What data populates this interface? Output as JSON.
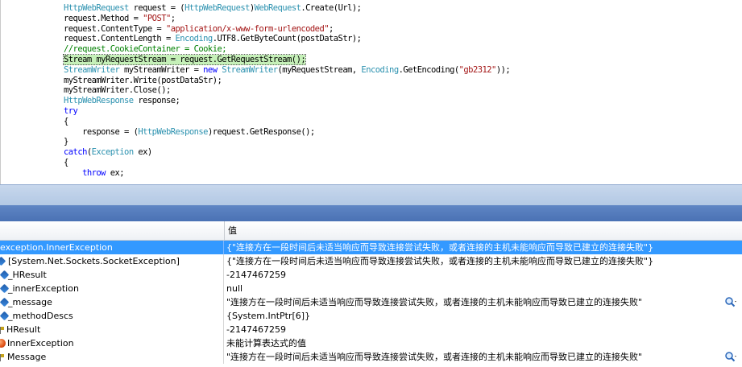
{
  "editor": {
    "lines": [
      [
        {
          "t": "HttpWebRequest",
          "c": "type"
        },
        {
          "t": " request = (",
          "c": "pl"
        },
        {
          "t": "HttpWebRequest",
          "c": "type"
        },
        {
          "t": ")",
          "c": "pl"
        },
        {
          "t": "WebRequest",
          "c": "type"
        },
        {
          "t": ".Create(Url);",
          "c": "pl"
        }
      ],
      [
        {
          "t": "request.Method = ",
          "c": "pl"
        },
        {
          "t": "\"POST\"",
          "c": "str"
        },
        {
          "t": ";",
          "c": "pl"
        }
      ],
      [
        {
          "t": "request.ContentType = ",
          "c": "pl"
        },
        {
          "t": "\"application/x-www-form-urlencoded\"",
          "c": "str"
        },
        {
          "t": ";",
          "c": "pl"
        }
      ],
      [
        {
          "t": "request.ContentLength = ",
          "c": "pl"
        },
        {
          "t": "Encoding",
          "c": "type"
        },
        {
          "t": ".UTF8.GetByteCount(postDataStr);",
          "c": "pl"
        }
      ],
      [
        {
          "t": "//request.CookieContainer = Cookie;",
          "c": "cm"
        }
      ],
      [
        {
          "t": "Stream myRequestStream = request.GetRequestStream();",
          "c": "pl"
        }
      ],
      [
        {
          "t": "StreamWriter",
          "c": "type"
        },
        {
          "t": " myStreamWriter = ",
          "c": "pl"
        },
        {
          "t": "new",
          "c": "kw"
        },
        {
          "t": " ",
          "c": "pl"
        },
        {
          "t": "StreamWriter",
          "c": "type"
        },
        {
          "t": "(myRequestStream, ",
          "c": "pl"
        },
        {
          "t": "Encoding",
          "c": "type"
        },
        {
          "t": ".GetEncoding(",
          "c": "pl"
        },
        {
          "t": "\"gb2312\"",
          "c": "str"
        },
        {
          "t": "));",
          "c": "pl"
        }
      ],
      [
        {
          "t": "myStreamWriter.Write(postDataStr);",
          "c": "pl"
        }
      ],
      [
        {
          "t": "myStreamWriter.Close();",
          "c": "pl"
        }
      ],
      [
        {
          "t": "HttpWebResponse",
          "c": "type"
        },
        {
          "t": " response;",
          "c": "pl"
        }
      ],
      [
        {
          "t": "try",
          "c": "kw"
        }
      ],
      [
        {
          "t": "{",
          "c": "pl"
        }
      ],
      [
        {
          "t": "    response = (",
          "c": "pl"
        },
        {
          "t": "HttpWebResponse",
          "c": "type"
        },
        {
          "t": ")request.GetResponse();",
          "c": "pl"
        }
      ],
      [
        {
          "t": "}",
          "c": "pl"
        }
      ],
      [
        {
          "t": "catch",
          "c": "kw"
        },
        {
          "t": "(",
          "c": "pl"
        },
        {
          "t": "Exception",
          "c": "type"
        },
        {
          "t": " ex)",
          "c": "pl"
        }
      ],
      [
        {
          "t": "{",
          "c": "pl"
        }
      ],
      [
        {
          "t": "    ",
          "c": "pl"
        },
        {
          "t": "throw",
          "c": "kw"
        },
        {
          "t": " ex;",
          "c": "pl"
        }
      ]
    ],
    "highlighted_line": 5
  },
  "grid": {
    "col_value": "值",
    "rows": [
      {
        "name": "exception.InnerException",
        "value": "{\"连接方在一段时间后未适当响应而导致连接尝试失败，或者连接的主机未能响应而导致已建立的连接失败\"}",
        "icon": "none",
        "selected": true,
        "search": false
      },
      {
        "name": "[System.Net.Sockets.SocketException]",
        "value": "{\"连接方在一段时间后未适当响应而导致连接尝试失败，或者连接的主机未能响应而导致已建立的连接失败\"}",
        "icon": "field",
        "selected": false,
        "search": false
      },
      {
        "name": "_HResult",
        "value": "-2147467259",
        "icon": "field",
        "selected": false,
        "search": false
      },
      {
        "name": "_innerException",
        "value": "null",
        "icon": "field",
        "selected": false,
        "search": false
      },
      {
        "name": "_message",
        "value": "\"连接方在一段时间后未适当响应而导致连接尝试失败，或者连接的主机未能响应而导致已建立的连接失败\"",
        "icon": "field",
        "selected": false,
        "search": true
      },
      {
        "name": "_methodDescs",
        "value": "{System.IntPtr[6]}",
        "icon": "field",
        "selected": false,
        "search": false
      },
      {
        "name": "HResult",
        "value": "-2147467259",
        "icon": "property",
        "selected": false,
        "search": false
      },
      {
        "name": "InnerException",
        "value": "未能计算表达式的值",
        "icon": "error",
        "selected": false,
        "search": false
      },
      {
        "name": "Message",
        "value": "\"连接方在一段时间后未适当响应而导致连接尝试失败，或者连接的主机未能响应而导致已建立的连接失败\"",
        "icon": "property",
        "selected": false,
        "search": true
      }
    ]
  },
  "colors": {
    "type": "#2b91af",
    "keyword": "#0000ff",
    "string": "#a31515",
    "comment": "#008000",
    "selection": "#3399ff",
    "current_line": "#c5f0b8"
  }
}
